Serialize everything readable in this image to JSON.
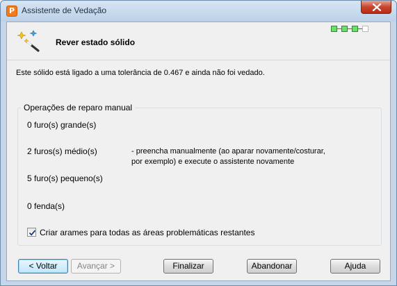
{
  "window": {
    "title": "Assistente de Vedação",
    "app_icon_letter": "P"
  },
  "header": {
    "step_title": "Rever estado sólido",
    "progress": {
      "total_steps": 4,
      "completed_steps": 3
    }
  },
  "info_text": "Este sólido está ligado a uma tolerância de 0.467 e ainda não foi vedado.",
  "group": {
    "title": "Operações de reparo manual",
    "rows": [
      "0 furo(s) grande(s)",
      "2 furos(s) médio(s)",
      "5 furo(s) pequeno(s)",
      "0 fenda(s)"
    ],
    "note_line1": "- preencha manualmente (ao aparar novamente/costurar,",
    "note_line2": "por exemplo) e execute o assistente novamente"
  },
  "checkbox": {
    "label": "Criar arames para todas as áreas problemáticas restantes",
    "checked": true
  },
  "buttons": {
    "back": "< Voltar",
    "next": "Avançar >",
    "finish": "Finalizar",
    "abort": "Abandonar",
    "help": "Ajuda"
  },
  "colors": {
    "progress_done": "#6ddd6d",
    "close_button": "#c7452e"
  }
}
